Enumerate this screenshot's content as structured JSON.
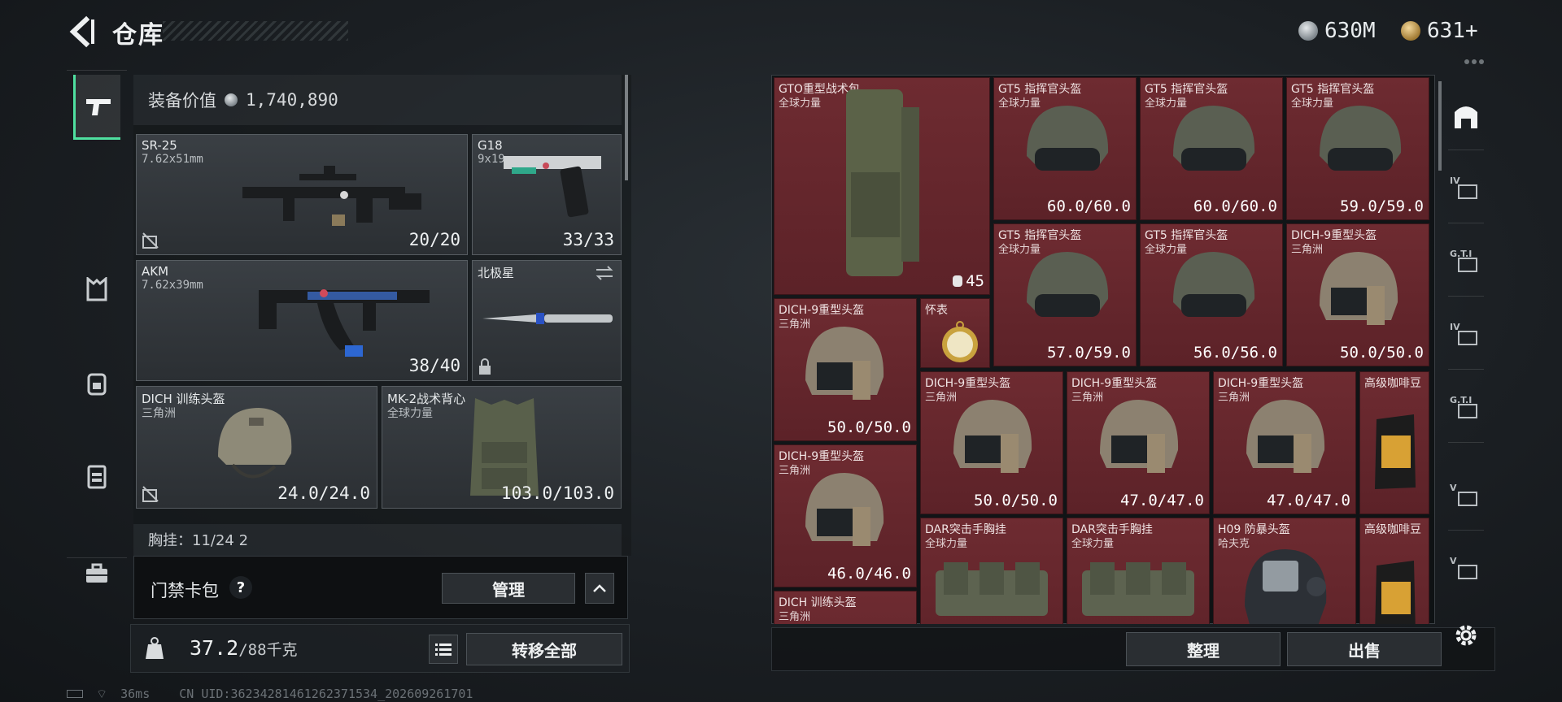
{
  "header": {
    "title": "仓库"
  },
  "currency": {
    "silver": "630M",
    "gold": "631+"
  },
  "left_nav": [
    "pistol-icon",
    "vest-icon",
    "backpack-icon",
    "chest-rig-icon",
    "briefcase-icon"
  ],
  "equipment": {
    "value_label": "装备价值",
    "value": "1,740,890",
    "slots": [
      {
        "name": "SR-25",
        "sub": "7.62x51mm",
        "value": "20/20"
      },
      {
        "name": "G18",
        "sub": "9x19mm",
        "value": "33/33"
      },
      {
        "name": "AKM",
        "sub": "7.62x39mm",
        "value": "38/40"
      },
      {
        "name": "北极星",
        "sub": "",
        "value": ""
      },
      {
        "name": "DICH 训练头盔",
        "sub": "三角洲",
        "value": "24.0/24.0"
      },
      {
        "name": "MK-2战术背心",
        "sub": "全球力量",
        "value": "103.0/103.0"
      }
    ],
    "chest_label": "胸挂：11/24 2"
  },
  "keycard": {
    "label": "门禁卡包",
    "help": "?",
    "manage": "管理"
  },
  "capacity": {
    "weight": "37.2",
    "max": "/88千克",
    "transfer_all": "转移全部"
  },
  "status": {
    "ping": "36ms",
    "uid": "CN UID:3623428146126237153­4_202609261701"
  },
  "storage": {
    "items": [
      {
        "n1": "GTO重型战术包",
        "n2": "全球力量",
        "v": "45"
      },
      {
        "n1": "GT5 指挥官头盔",
        "n2": "全球力量",
        "v": "60.0/60.0"
      },
      {
        "n1": "GT5 指挥官头盔",
        "n2": "全球力量",
        "v": "60.0/60.0"
      },
      {
        "n1": "GT5 指挥官头盔",
        "n2": "全球力量",
        "v": "59.0/59.0"
      },
      {
        "n1": "GT5 指挥官头盔",
        "n2": "全球力量",
        "v": "57.0/59.0"
      },
      {
        "n1": "GT5 指挥官头盔",
        "n2": "全球力量",
        "v": "56.0/56.0"
      },
      {
        "n1": "DICH-9重型头盔",
        "n2": "三角洲",
        "v": "50.0/50.0"
      },
      {
        "n1": "DICH-9重型头盔",
        "n2": "三角洲",
        "v": "50.0/50.0"
      },
      {
        "n1": "怀表",
        "n2": "",
        "v": ""
      },
      {
        "n1": "DICH-9重型头盔",
        "n2": "三角洲",
        "v": "50.0/50.0"
      },
      {
        "n1": "DICH-9重型头盔",
        "n2": "三角洲",
        "v": "47.0/47.0"
      },
      {
        "n1": "DICH-9重型头盔",
        "n2": "三角洲",
        "v": "47.0/47.0"
      },
      {
        "n1": "高级咖啡豆",
        "n2": "",
        "v": ""
      },
      {
        "n1": "DICH-9重型头盔",
        "n2": "三角洲",
        "v": "46.0/46.0"
      },
      {
        "n1": "DAR突击手胸挂",
        "n2": "全球力量",
        "v": ""
      },
      {
        "n1": "DAR突击手胸挂",
        "n2": "全球力量",
        "v": ""
      },
      {
        "n1": "H09 防暴头盔",
        "n2": "哈夫克",
        "v": ""
      },
      {
        "n1": "高级咖啡豆",
        "n2": "",
        "v": ""
      },
      {
        "n1": "DICH 训练头盔",
        "n2": "三角洲",
        "v": ""
      }
    ],
    "sort": "整理",
    "sell": "出售"
  },
  "right_nav": [
    "map-icon",
    "IV",
    "G.T.I",
    "IV",
    "G.T.I",
    "V",
    "V",
    "gear-icon"
  ],
  "colors": {
    "accent": "#4fe0a0",
    "item_bg": "#6e2b31"
  }
}
